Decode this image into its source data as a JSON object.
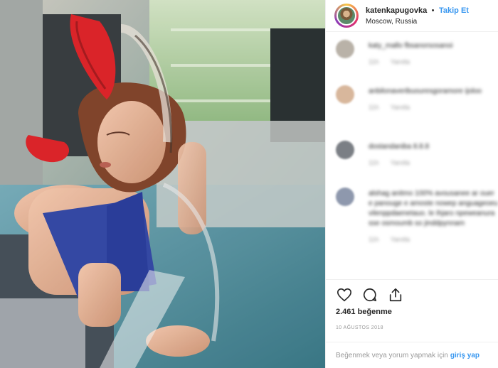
{
  "post": {
    "username": "katenkapugovka",
    "separator": "•",
    "follow_label": "Takip Et",
    "location": "Moscow, Russia",
    "likes_text": "2.461 beğenme",
    "date_text": "10 AĞUSTOS 2018"
  },
  "comments": [
    {
      "text": "katy_mallo  fbsanorsosanoi",
      "time": "11h",
      "reply": "Yanıtla"
    },
    {
      "text": "anbilonaveribuouresgoramore ijoloo",
      "time": "11h",
      "reply": "Yanıtla"
    },
    {
      "text": "dostandaniba 8.8.8",
      "time": "11h",
      "reply": "Yanıtla"
    },
    {
      "text": "alshag anitmo 100% avousanee ar ouere panouge e amoste nowep anguageoeuvilenppdaenetauo. le ihjaro npeweanurasse osmoumb so jinddpynnam",
      "time": "11h",
      "reply": "Yanıtla"
    }
  ],
  "actions": {
    "like_icon": "heart-icon",
    "comment_icon": "comment-icon",
    "share_icon": "share-icon"
  },
  "footer": {
    "prompt": "Beğenmek veya yorum yapmak için",
    "link": "giriş yap"
  },
  "colors": {
    "accent": "#3897f0",
    "text": "#262626",
    "muted": "#999999",
    "border": "#efefef"
  }
}
